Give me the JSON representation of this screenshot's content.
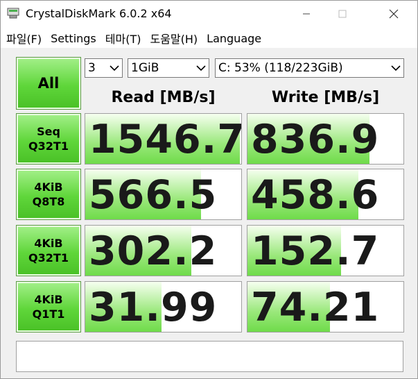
{
  "window": {
    "title": "CrystalDiskMark 6.0.2 x64"
  },
  "menu": [
    "파일(F)",
    "Settings",
    "테마(T)",
    "도움말(H)",
    "Language"
  ],
  "controls": {
    "all_label": "All",
    "count": "3",
    "size": "1GiB",
    "drive": "C: 53% (118/223GiB)"
  },
  "headers": {
    "read": "Read [MB/s]",
    "write": "Write [MB/s]"
  },
  "tests": [
    {
      "line1": "Seq",
      "line2": "Q32T1",
      "read": "1546.7",
      "write": "836.9",
      "read_fill": 0.99,
      "write_fill": 0.78
    },
    {
      "line1": "4KiB",
      "line2": "Q8T8",
      "read": "566.5",
      "write": "458.6",
      "read_fill": 0.74,
      "write_fill": 0.71
    },
    {
      "line1": "4KiB",
      "line2": "Q32T1",
      "read": "302.2",
      "write": "152.7",
      "read_fill": 0.68,
      "write_fill": 0.6
    },
    {
      "line1": "4KiB",
      "line2": "Q1T1",
      "read": "31.99",
      "write": "74.21",
      "read_fill": 0.49,
      "write_fill": 0.53
    }
  ],
  "comment": ""
}
